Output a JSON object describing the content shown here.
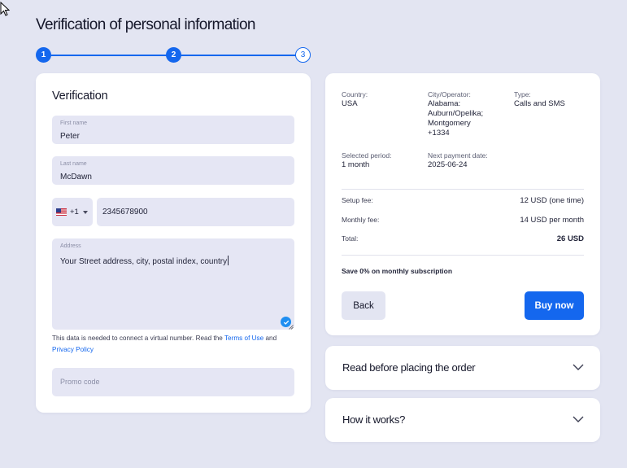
{
  "page": {
    "title": "Verification of personal information"
  },
  "stepper": {
    "steps": [
      "1",
      "2",
      "3"
    ],
    "current_step": 2
  },
  "form": {
    "title": "Verification",
    "first_name": {
      "label": "First name",
      "value": "Peter"
    },
    "last_name": {
      "label": "Last name",
      "value": "McDawn"
    },
    "phone": {
      "country_code": "+1",
      "flag": "us-flag-icon",
      "value": "2345678900"
    },
    "address": {
      "label": "Address",
      "value": "Your Street address, city, postal index, country"
    },
    "note": {
      "text_before": "This data is needed to connect a virtual number. Read the ",
      "terms_link": "Terms of Use",
      "text_middle": " and ",
      "privacy_link": "Privacy Policy"
    },
    "promo": {
      "placeholder": "Promo code"
    }
  },
  "summary": {
    "country": {
      "label": "Country:",
      "value": "USA"
    },
    "city": {
      "label": "City/Operator:",
      "lines": [
        "Alabama:",
        "Auburn/Opelika;",
        "Montgomery",
        "+1334"
      ]
    },
    "type": {
      "label": "Type:",
      "value": "Calls and SMS"
    },
    "period": {
      "label": "Selected period:",
      "value": "1 month"
    },
    "next_payment": {
      "label": "Next payment date:",
      "value": "2025-06-24"
    },
    "fees": {
      "setup": {
        "label": "Setup fee:",
        "value": "12 USD (one time)"
      },
      "monthly": {
        "label": "Monthly fee:",
        "value": "14 USD per month"
      },
      "total": {
        "label": "Total:",
        "value": "26 USD"
      }
    },
    "save_note": "Save 0% on monthly subscription",
    "back_label": "Back",
    "buy_label": "Buy now"
  },
  "accordions": [
    {
      "title": "Read before placing the order"
    },
    {
      "title": "How it works?"
    }
  ],
  "colors": {
    "accent": "#1467ee",
    "background": "#e3e5f2",
    "field_bg": "#e5e6f4"
  }
}
